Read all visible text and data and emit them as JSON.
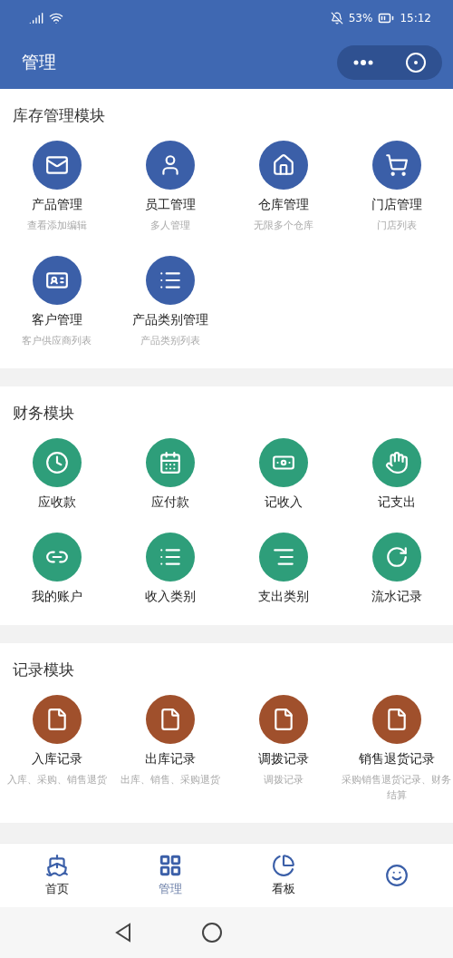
{
  "status_bar": {
    "battery": "53%",
    "time": "15:12"
  },
  "header": {
    "title": "管理"
  },
  "sections": [
    {
      "title": "库存管理模块",
      "color": "#3b5fa8",
      "items": [
        {
          "label": "产品管理",
          "subtitle": "查看添加编辑"
        },
        {
          "label": "员工管理",
          "subtitle": "多人管理"
        },
        {
          "label": "仓库管理",
          "subtitle": "无限多个仓库"
        },
        {
          "label": "门店管理",
          "subtitle": "门店列表"
        },
        {
          "label": "客户管理",
          "subtitle": "客户供应商列表"
        },
        {
          "label": "产品类别管理",
          "subtitle": "产品类别列表"
        }
      ]
    },
    {
      "title": "财务模块",
      "color": "#2e9e7a",
      "items": [
        {
          "label": "应收款"
        },
        {
          "label": "应付款"
        },
        {
          "label": "记收入"
        },
        {
          "label": "记支出"
        },
        {
          "label": "我的账户"
        },
        {
          "label": "收入类别"
        },
        {
          "label": "支出类别"
        },
        {
          "label": "流水记录"
        }
      ]
    },
    {
      "title": "记录模块",
      "color": "#a0502c",
      "items": [
        {
          "label": "入库记录",
          "subtitle": "入库、采购、销售退货"
        },
        {
          "label": "出库记录",
          "subtitle": "出库、销售、采购退货"
        },
        {
          "label": "调拨记录",
          "subtitle": "调拨记录"
        },
        {
          "label": "销售退货记录",
          "subtitle": "采购销售退货记录、财务结算"
        }
      ]
    }
  ],
  "tab_bar": [
    {
      "label": "首页",
      "selected": false
    },
    {
      "label": "管理",
      "selected": true
    },
    {
      "label": "看板",
      "selected": false
    },
    {
      "selected": false
    }
  ]
}
